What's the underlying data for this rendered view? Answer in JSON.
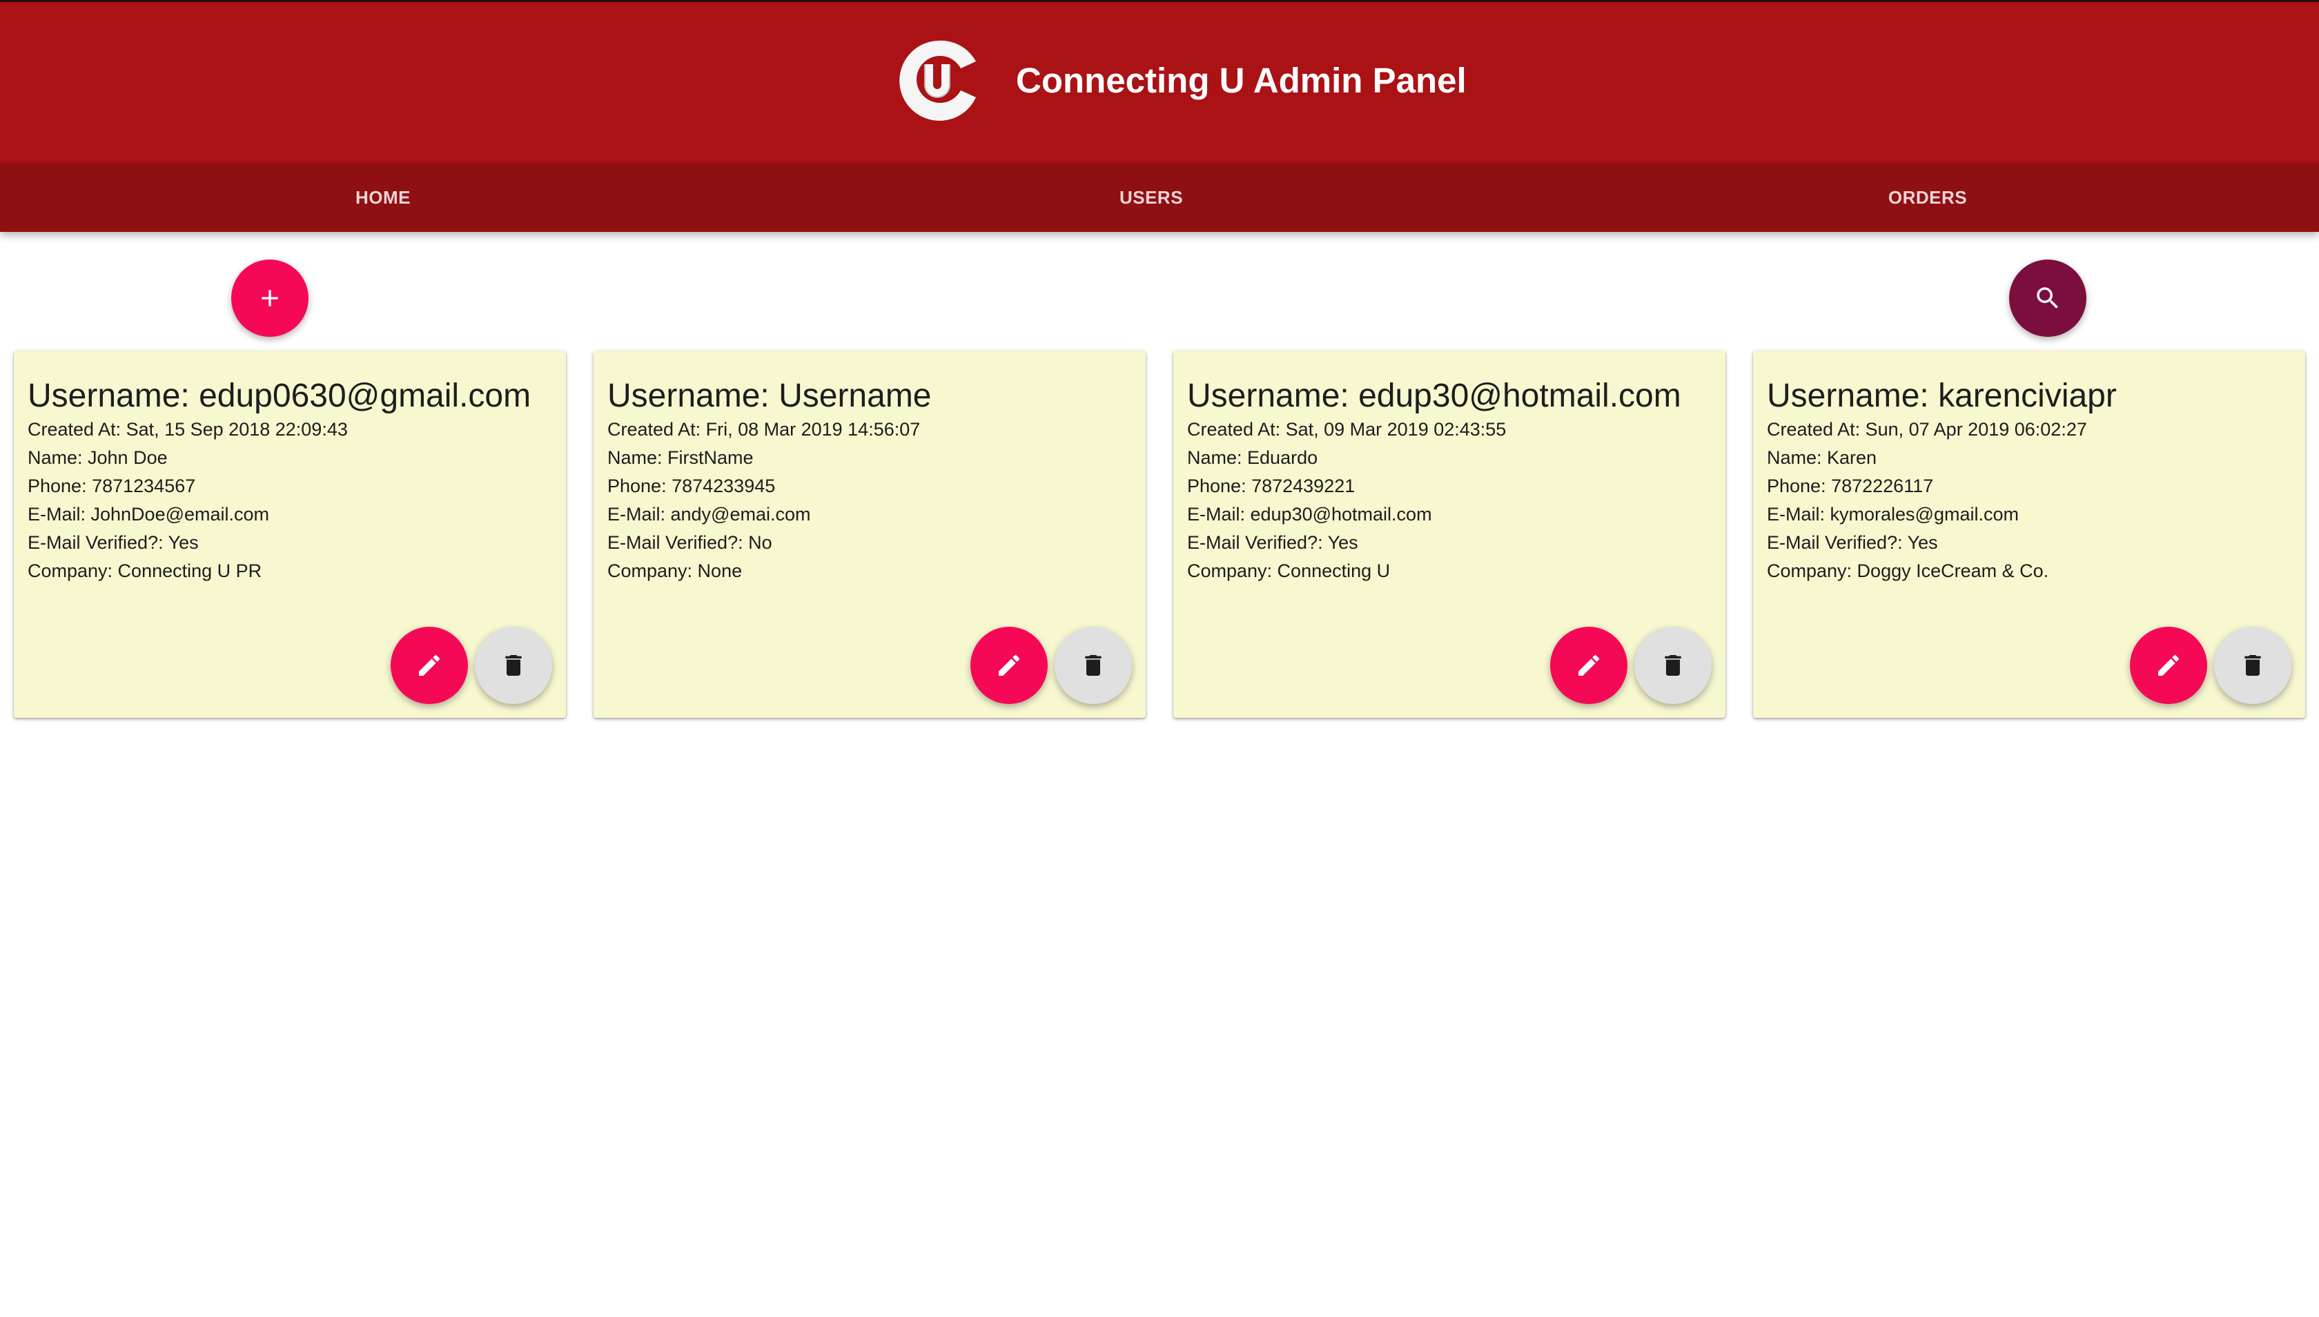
{
  "header": {
    "title": "Connecting U Admin Panel",
    "logo_icon": "connecting-u-logo"
  },
  "nav": {
    "tabs": [
      {
        "label": "HOME"
      },
      {
        "label": "USERS"
      },
      {
        "label": "ORDERS"
      }
    ]
  },
  "actions": {
    "add_icon": "plus-icon",
    "search_icon": "search-icon"
  },
  "colors": {
    "header_bg": "#ab1215",
    "nav_bg": "#8e1013",
    "accent_pink": "#f50957",
    "search_fab": "#7b0e3f",
    "card_bg": "#f7f7d0"
  },
  "users": [
    {
      "title": "Username: edup0630@gmail.com",
      "created": "Created At: Sat, 15 Sep 2018 22:09:43",
      "name": "Name: John Doe",
      "phone": "Phone: 7871234567",
      "email": "E-Mail: JohnDoe@email.com",
      "verified": "E-Mail Verified?: Yes",
      "company": "Company: Connecting U PR"
    },
    {
      "title": "Username: Username",
      "created": "Created At: Fri, 08 Mar 2019 14:56:07",
      "name": "Name: FirstName",
      "phone": "Phone: 7874233945",
      "email": "E-Mail: andy@emai.com",
      "verified": "E-Mail Verified?: No",
      "company": "Company: None"
    },
    {
      "title": "Username: edup30@hotmail.com",
      "created": "Created At: Sat, 09 Mar 2019 02:43:55",
      "name": "Name: Eduardo",
      "phone": "Phone: 7872439221",
      "email": "E-Mail: edup30@hotmail.com",
      "verified": "E-Mail Verified?: Yes",
      "company": "Company: Connecting U"
    },
    {
      "title": "Username: karenciviapr",
      "created": "Created At: Sun, 07 Apr 2019 06:02:27",
      "name": "Name: Karen",
      "phone": "Phone: 7872226117",
      "email": "E-Mail: kymorales@gmail.com",
      "verified": "E-Mail Verified?: Yes",
      "company": "Company: Doggy IceCream & Co."
    }
  ]
}
